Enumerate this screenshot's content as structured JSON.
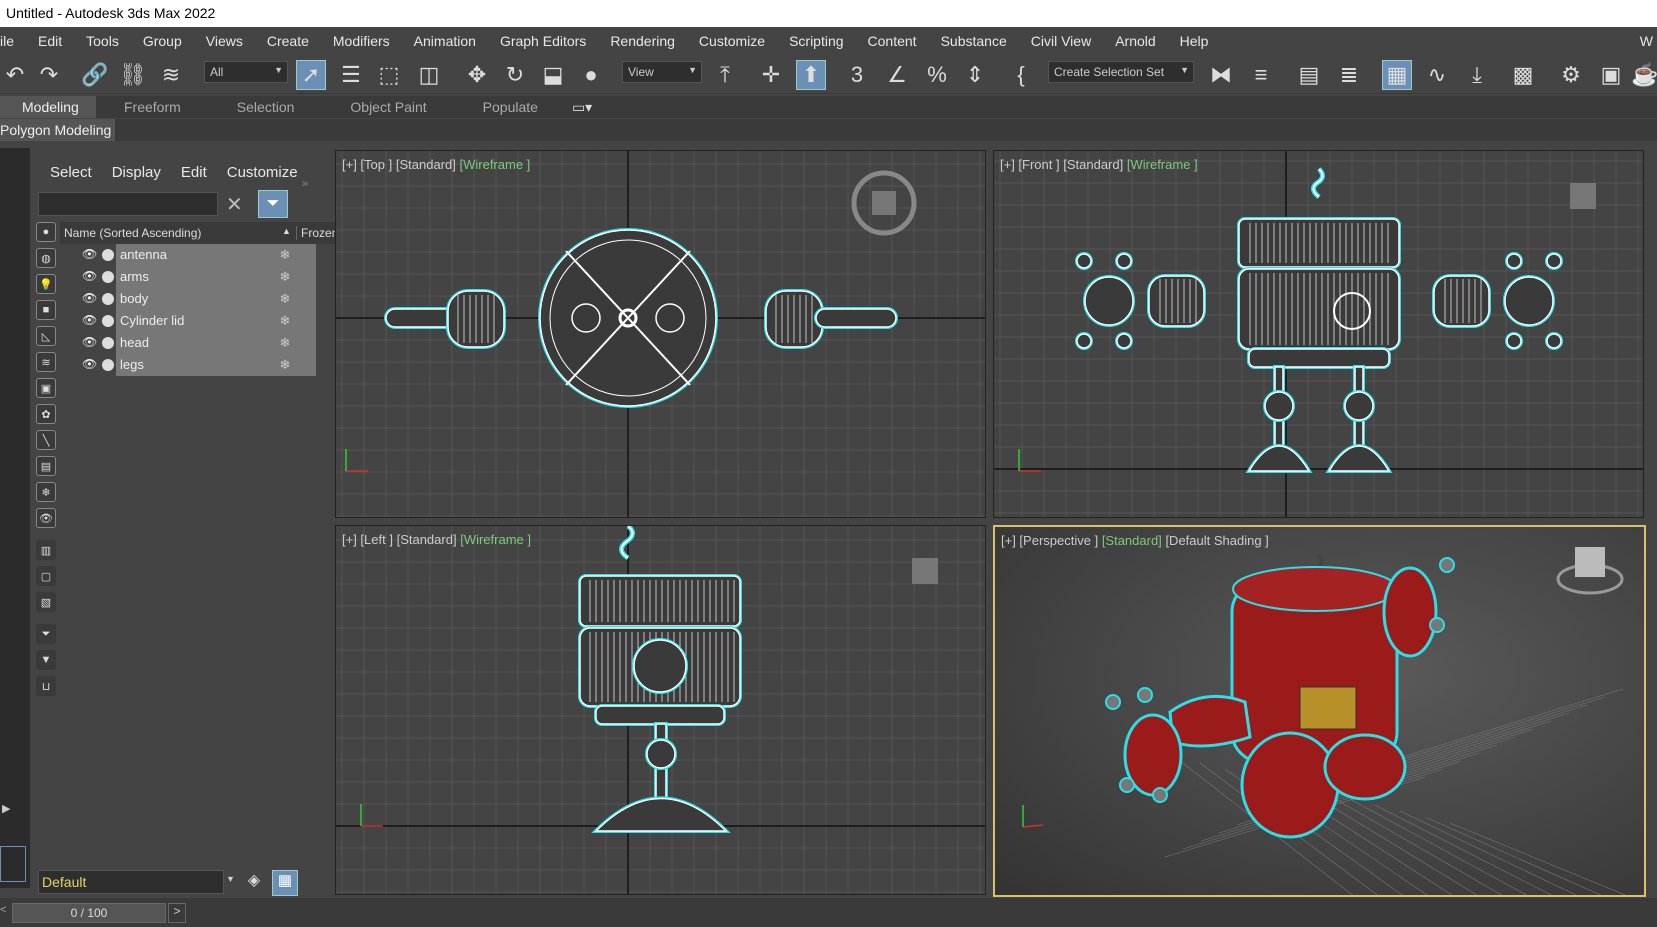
{
  "window": {
    "title": "Untitled - Autodesk 3ds Max 2022"
  },
  "menu": [
    "ile",
    "Edit",
    "Tools",
    "Group",
    "Views",
    "Create",
    "Modifiers",
    "Animation",
    "Graph Editors",
    "Rendering",
    "Customize",
    "Scripting",
    "Content",
    "Substance",
    "Civil View",
    "Arnold",
    "Help",
    "W"
  ],
  "toolbar": {
    "filter_combo": "All",
    "ref_coord_combo": "View",
    "selection_set_combo": "Create Selection Set",
    "icons": [
      "undo-icon",
      "redo-icon",
      "link-icon",
      "unlink-icon",
      "bind-space-warp-icon",
      "select-object-icon",
      "select-by-name-icon",
      "rect-region-icon",
      "window-crossing-icon",
      "move-icon",
      "rotate-icon",
      "scale-icon",
      "place-icon",
      "pivot-icon",
      "snap-icon",
      "angle-snap-icon",
      "percent-snap-icon",
      "spinner-snap-icon",
      "named-selection-icon",
      "mirror-icon",
      "align-icon",
      "scene-explorer-icon",
      "layer-explorer-icon",
      "ribbon-toggle-icon",
      "curve-editor-icon",
      "schematic-icon",
      "material-editor-icon",
      "render-setup-icon",
      "rendered-frame-icon",
      "render-icon"
    ]
  },
  "ribbon": {
    "tabs": [
      "Modeling",
      "Freeform",
      "Selection",
      "Object Paint",
      "Populate"
    ],
    "active_tab": "Modeling",
    "panel": "Polygon Modeling"
  },
  "scene_explorer": {
    "menu": [
      "Select",
      "Display",
      "Edit",
      "Customize"
    ],
    "search_placeholder": "",
    "columns": {
      "name": "Name (Sorted Ascending)",
      "frozen": "Frozen"
    },
    "objects": [
      "antenna",
      "arms",
      "body",
      "Cylinder lid",
      "head",
      "legs"
    ]
  },
  "layer": {
    "current": "Default"
  },
  "timeline": {
    "frame": "0 / 100"
  },
  "viewports": {
    "top": {
      "label_a": "[+] [Top ]",
      "label_b": "[Standard]",
      "label_c": "[Wireframe ]"
    },
    "front": {
      "label_a": "[+] [Front ]",
      "label_b": "[Standard]",
      "label_c": "[Wireframe ]"
    },
    "left": {
      "label_a": "[+] [Left ]",
      "label_b": "[Standard]",
      "label_c": "[Wireframe ]"
    },
    "persp": {
      "label_a": "[+] [Perspective ]",
      "label_b": "[Standard]",
      "label_c": "[Default Shading ]"
    }
  },
  "colors": {
    "accent": "#6b8fb5",
    "wire": "#ffffff",
    "outline": "#29e0e8",
    "robot_red": "#9b1a1a",
    "active_border": "#d8c26a"
  }
}
